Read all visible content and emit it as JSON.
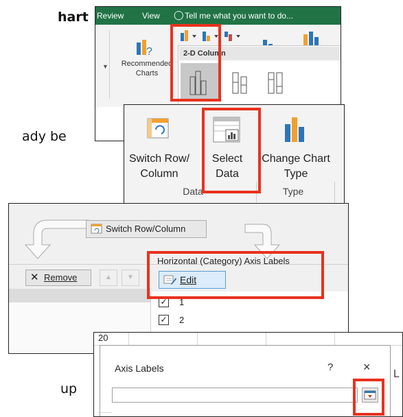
{
  "background": {
    "heading_fragment": "hart",
    "text_fragment_1": "ady be",
    "text_fragment_2": "up"
  },
  "ribbon_insert": {
    "tabs": [
      "Review",
      "View"
    ],
    "tell_me": "Tell me what you want to do...",
    "recommended_label": "Recommended Charts",
    "dropdown_header": "2-D Column",
    "colors": {
      "ribbon_green": "#217346",
      "highlight": "#e8321e"
    }
  },
  "ribbon_design": {
    "switch_row_col": "Switch Row/ Column",
    "select_data": "Select Data",
    "change_chart_type": "Change Chart Type",
    "group_data": "Data",
    "group_type": "Type"
  },
  "select_data_dialog": {
    "switch_button": "Switch Row/Column",
    "remove_button": "Remove",
    "axis_header": "Horizontal (Category) Axis Labels",
    "edit_button": "Edit",
    "axis_items": [
      "1",
      "2"
    ]
  },
  "axis_labels_dialog": {
    "row_top": "20",
    "title": "Axis Labels",
    "help": "?",
    "close": "×",
    "input_value": "",
    "side_fragment": "L"
  }
}
